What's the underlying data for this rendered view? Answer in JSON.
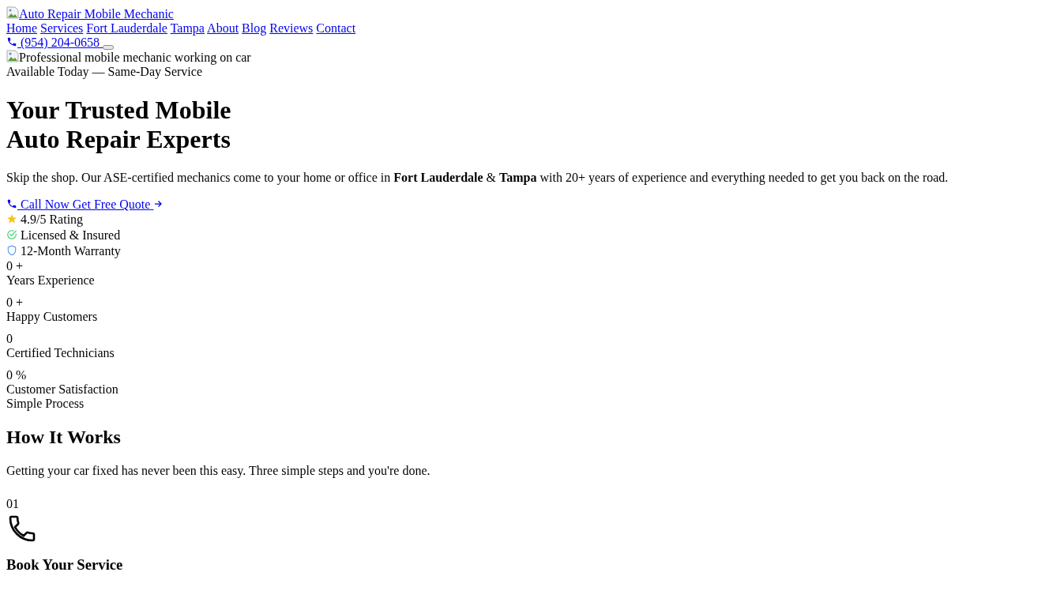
{
  "header": {
    "logo_alt": "Auto Repair Mobile Mechanic",
    "nav": [
      {
        "label": "Home"
      },
      {
        "label": "Services"
      },
      {
        "label": "Fort Lauderdale"
      },
      {
        "label": "Tampa"
      },
      {
        "label": "About"
      },
      {
        "label": "Blog"
      },
      {
        "label": "Reviews"
      },
      {
        "label": "Contact"
      }
    ],
    "phone": "(954) 204-0658"
  },
  "hero": {
    "image_alt": "Professional mobile mechanic working on car",
    "badge": "Available Today — Same-Day Service",
    "title_lines": [
      "Your Trusted Mobile",
      "Auto Repair Experts"
    ],
    "intro": "Skip the shop. Our ASE-certified mechanics come to your home or office in **Fort Lauderdale** & **Tampa** with 20+ years of experience and everything needed to get you back on the road.",
    "cta": "Call Now Get Free Quote",
    "trust": [
      {
        "kind": "star",
        "label": "4.9/5 Rating"
      },
      {
        "kind": "check",
        "label": "Licensed & Insured"
      },
      {
        "kind": "shield",
        "label": "12-Month Warranty"
      }
    ]
  },
  "stats": [
    {
      "value": "0",
      "suffix": "+",
      "label": "Years Experience"
    },
    {
      "value": "0",
      "suffix": "+",
      "label": "Happy Customers"
    },
    {
      "value": "0",
      "label": "Certified Technicians"
    },
    {
      "value": "0",
      "suffix": "%",
      "label": "Customer Satisfaction"
    }
  ],
  "process": {
    "eyebrow": "Simple Process",
    "title": "How It Works",
    "subtitle": "Getting your car fixed has never been this easy. Three simple steps and you're done.",
    "steps": [
      {
        "number": "01",
        "kind": "phone",
        "title": "Book Your Service"
      }
    ]
  }
}
